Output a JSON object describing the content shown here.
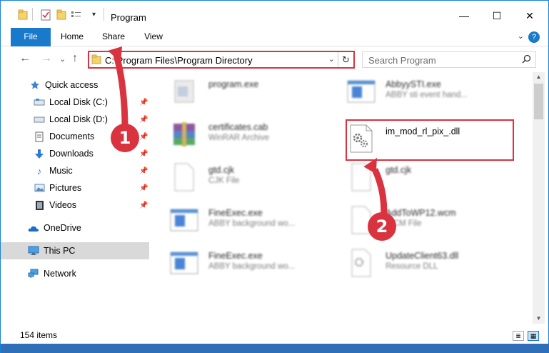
{
  "window": {
    "title": "Program",
    "minimize": "—",
    "maximize": "☐",
    "close": "✕"
  },
  "ribbon": {
    "tabs": [
      "File",
      "Home",
      "Share",
      "View"
    ],
    "help": "?",
    "expand": "⌄"
  },
  "nav": {
    "back": "←",
    "forward": "→",
    "recent": "⌄",
    "up": "↑",
    "address": "C:\\Program Files\\Program Directory",
    "dropdown": "⌄",
    "refresh": "↻",
    "search_placeholder": "Search Program"
  },
  "sidebar": {
    "items": [
      {
        "label": "Quick access",
        "icon": "star-icon"
      },
      {
        "label": "Local Disk (C:)",
        "icon": "drive-icon",
        "pinned": true
      },
      {
        "label": "Local Disk (D:)",
        "icon": "drive-icon",
        "pinned": true
      },
      {
        "label": "Documents",
        "icon": "documents-icon",
        "pinned": true
      },
      {
        "label": "Downloads",
        "icon": "downloads-icon",
        "pinned": true
      },
      {
        "label": "Music",
        "icon": "music-icon",
        "pinned": true
      },
      {
        "label": "Pictures",
        "icon": "pictures-icon",
        "pinned": true
      },
      {
        "label": "Videos",
        "icon": "videos-icon",
        "pinned": true
      },
      {
        "label": "OneDrive",
        "icon": "cloud-icon"
      },
      {
        "label": "This PC",
        "icon": "computer-icon",
        "selected": true
      },
      {
        "label": "Network",
        "icon": "network-icon"
      }
    ],
    "pin_glyph": "📌"
  },
  "files": [
    {
      "name": "program.exe",
      "type": ""
    },
    {
      "name": "AbbyySTI.exe",
      "type": "ABBY sti event hand..."
    },
    {
      "name": "certificates.cab",
      "type": "WinRAR Archive"
    },
    {
      "name": "im_mod_rl_pix_.dll",
      "type": ""
    },
    {
      "name": "gtd.cjk",
      "type": "CJK File"
    },
    {
      "name": "gtd.cjk",
      "type": ""
    },
    {
      "name": "FineExec.exe",
      "type": "ABBY background wo..."
    },
    {
      "name": "AddToWP12.wcm",
      "type": "WCM File"
    },
    {
      "name": "FineExec.exe",
      "type": "ABBY background wo..."
    },
    {
      "name": "UpdateClient63.dll",
      "type": "Resource DLL"
    }
  ],
  "status": {
    "count": "154 items"
  },
  "markers": [
    "1",
    "2"
  ],
  "colors": {
    "accent": "#1979ca",
    "highlight": "#d9333f"
  }
}
